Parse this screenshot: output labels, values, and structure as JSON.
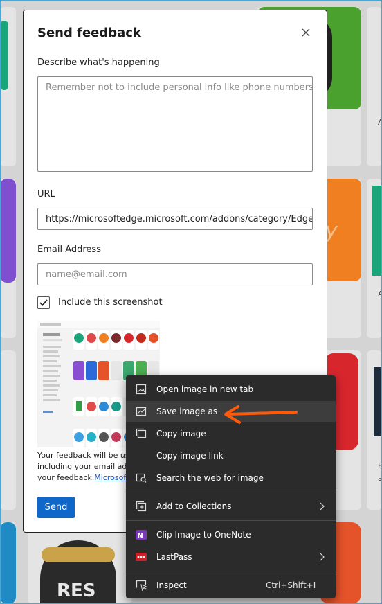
{
  "dialog": {
    "title": "Send feedback",
    "describe_label": "Describe what's happening",
    "describe_placeholder": "Remember not to include personal info like phone numbers.",
    "url_label": "URL",
    "url_value": "https://microsoftedge.microsoft.com/addons/category/EdgeE",
    "email_label": "Email Address",
    "email_placeholder": "name@email.com",
    "include_screenshot_label": "Include this screenshot",
    "include_screenshot_checked": true,
    "note_line1": "Your feedback will be us",
    "note_line2": "including your email add",
    "note_line3": "your feedback.",
    "note_link": "Microsoft",
    "send_label": "Send"
  },
  "context_menu": {
    "items": [
      {
        "label": "Open image in new tab",
        "icon": "open-image-icon"
      },
      {
        "label": "Save image as",
        "icon": "save-image-icon",
        "highlighted": true
      },
      {
        "label": "Copy image",
        "icon": "copy-image-icon"
      },
      {
        "label": "Copy image link",
        "icon": ""
      },
      {
        "label": "Search the web for image",
        "icon": "search-image-icon"
      },
      {
        "label": "Add to Collections",
        "icon": "collections-icon",
        "submenu": true
      },
      {
        "label": "Clip Image to OneNote",
        "icon": "onenote-icon"
      },
      {
        "label": "LastPass",
        "icon": "lastpass-icon",
        "submenu": true
      },
      {
        "label": "Inspect",
        "icon": "inspect-icon",
        "shortcut": "Ctrl+Shift+I"
      }
    ]
  },
  "background": {
    "partial_texts": [
      "y",
      "A",
      "A",
      "E",
      "a",
      "RES"
    ]
  },
  "colors": {
    "accent": "#0f67c9",
    "menu_bg": "#2b2b2b",
    "annotation_arrow": "#ff5a0a",
    "link": "#1a55c6"
  }
}
